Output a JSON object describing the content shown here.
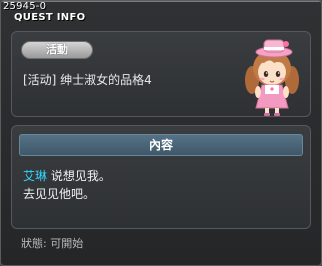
{
  "window": {
    "quest_id": "25945-0",
    "title": "QUEST INFO"
  },
  "quest": {
    "category_label": "活動",
    "name": "[活动] 绅士淑女的品格4"
  },
  "content": {
    "header_label": "內容",
    "npc_name": "艾琳",
    "line1_rest": " 说想见我。",
    "line2": "去见见他吧。"
  },
  "status": {
    "text": "狀態:  可開始"
  },
  "colors": {
    "npc_name": "#33d6ff",
    "header_bg": "#4a6577",
    "panel_bg": "#33363a"
  },
  "icons": {
    "npc_portrait": "npc-girl-portrait"
  }
}
